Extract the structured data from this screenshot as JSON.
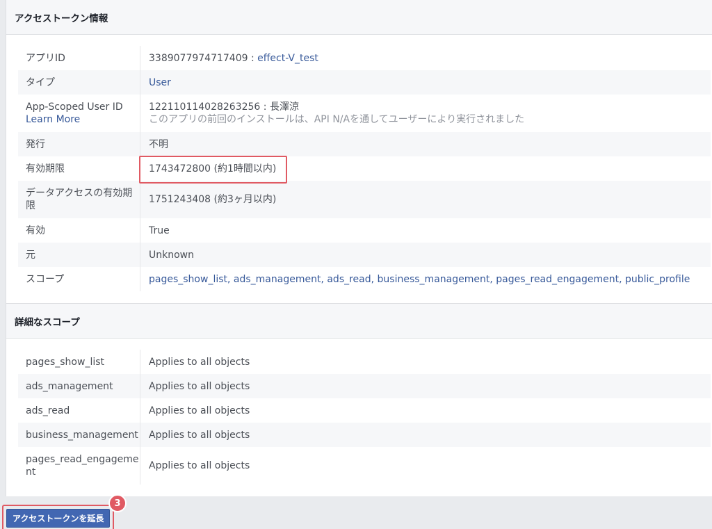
{
  "section_access_token": {
    "title": "アクセストークン情報",
    "rows": [
      {
        "label": "アプリID",
        "value": "3389077974717409 : ",
        "link": "effect-V_test"
      },
      {
        "label": "タイプ",
        "link": "User"
      },
      {
        "label": "App-Scoped User ID",
        "label_link": "Learn More",
        "value": "122110114028263256 : 長澤涼",
        "sub": "このアプリの前回のインストールは、API N/Aを通してユーザーにより実行されました"
      },
      {
        "label": "発行",
        "value": "不明"
      },
      {
        "label": "有効期限",
        "value": "1743472800 (約1時間以内)"
      },
      {
        "label": "データアクセスの有効期限",
        "value": "1751243408 (約3ヶ月以内)"
      },
      {
        "label": "有効",
        "value": "True"
      },
      {
        "label": "元",
        "value": "Unknown"
      },
      {
        "label": "スコープ",
        "link": "pages_show_list, ads_management, ads_read, business_management, pages_read_engagement, public_profile"
      }
    ]
  },
  "section_detailed_scope": {
    "title": "詳細なスコープ",
    "rows": [
      {
        "label": "pages_show_list",
        "value": "Applies to all objects"
      },
      {
        "label": "ads_management",
        "value": "Applies to all objects"
      },
      {
        "label": "ads_read",
        "value": "Applies to all objects"
      },
      {
        "label": "business_management",
        "value": "Applies to all objects"
      },
      {
        "label": "pages_read_engagement",
        "value": "Applies to all objects"
      }
    ]
  },
  "footer": {
    "extend_button": "アクセストークンを延長",
    "step_badge": "3"
  },
  "colors": {
    "highlight": "#e05a63",
    "button": "#4267b2",
    "link": "#365899"
  }
}
